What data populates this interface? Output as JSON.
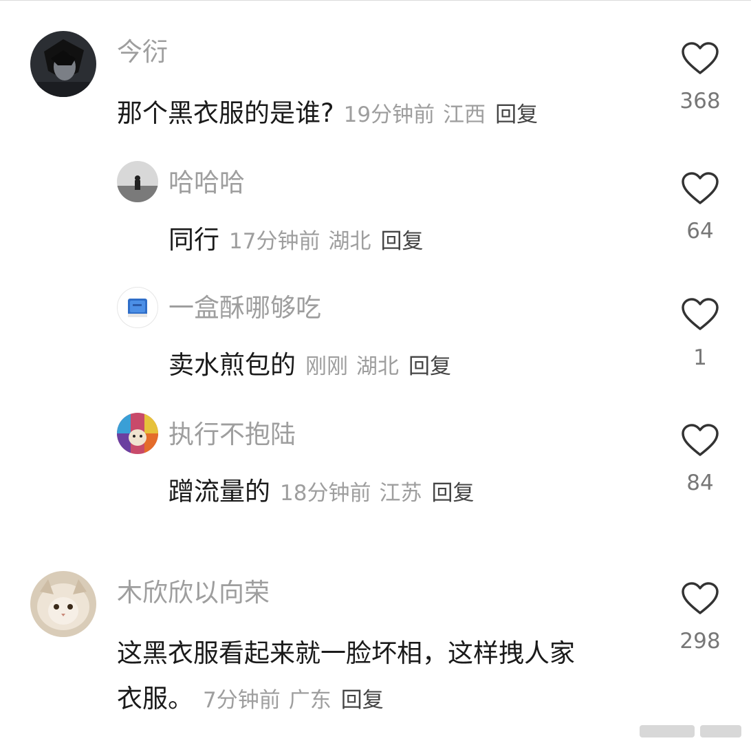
{
  "comments": [
    {
      "user": "今衍",
      "text": "那个黑衣服的是谁?",
      "time": "19分钟前",
      "location": "江西",
      "reply": "回复",
      "likes": "368",
      "replies": [
        {
          "user": "哈哈哈",
          "text": "同行",
          "time": "17分钟前",
          "location": "湖北",
          "reply": "回复",
          "likes": "64"
        },
        {
          "user": "一盒酥哪够吃",
          "text": "卖水煎包的",
          "time": "刚刚",
          "location": "湖北",
          "reply": "回复",
          "likes": "1"
        },
        {
          "user": "执行不抱陆",
          "text": "蹭流量的",
          "time": "18分钟前",
          "location": "江苏",
          "reply": "回复",
          "likes": "84"
        }
      ]
    },
    {
      "user": "木欣欣以向荣",
      "text_line1": "这黑衣服看起来就一脸坏相，这样拽人家",
      "text_line2": "衣服。",
      "time": "7分钟前",
      "location": "广东",
      "reply": "回复",
      "likes": "298"
    }
  ],
  "icons": {
    "like": "heart-outline-icon"
  },
  "colors": {
    "name": "#9e9e9e",
    "text": "#1a1a1a",
    "meta": "#9e9e9e"
  }
}
